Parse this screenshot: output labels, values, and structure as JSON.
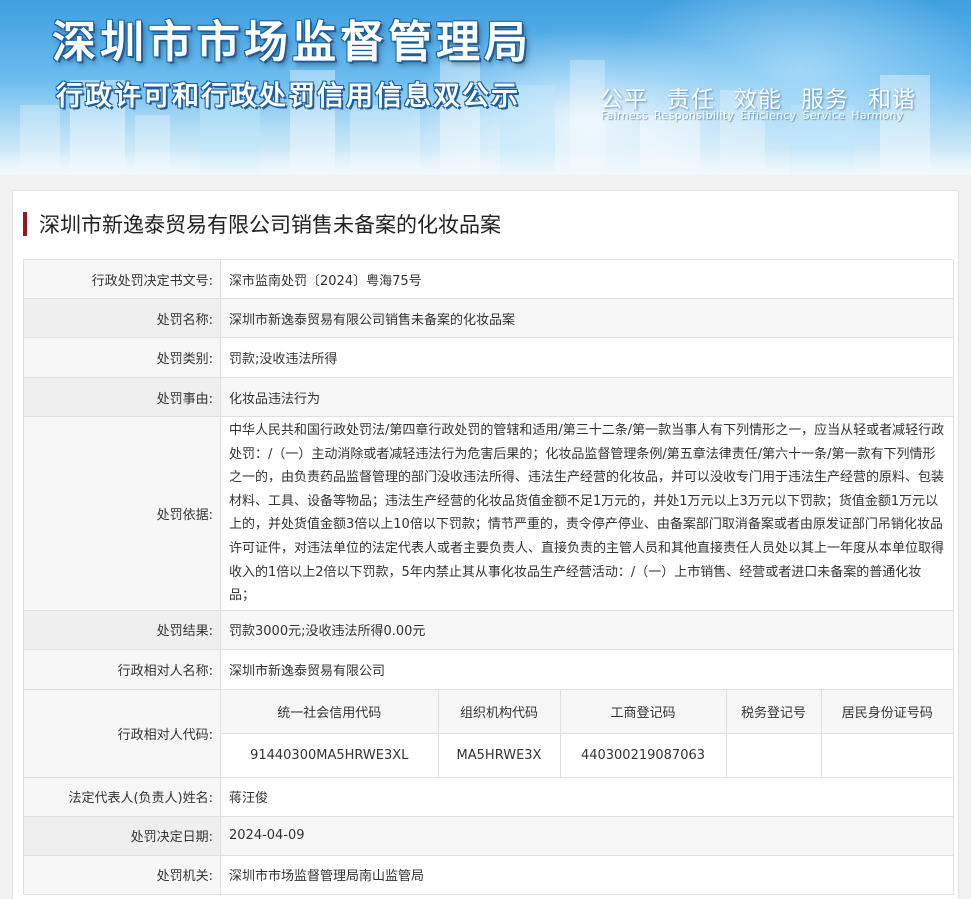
{
  "banner": {
    "title": "深圳市市场监督管理局",
    "subtitle": "行政许可和行政处罚信用信息双公示",
    "slogans_cn": [
      "公平",
      "责任",
      "效能",
      "服务",
      "和谐"
    ],
    "slogans_en": [
      "Fairness",
      "Responsibility",
      "Efficiency",
      "Service",
      "Harmony"
    ]
  },
  "page_title": "深圳市新逸泰贸易有限公司销售未备案的化妆品案",
  "details": {
    "decision_no_label": "行政处罚决定书文号:",
    "decision_no": "深市监南处罚〔2024〕粤海75号",
    "penalty_name_label": "处罚名称:",
    "penalty_name": "深圳市新逸泰贸易有限公司销售未备案的化妆品案",
    "penalty_type_label": "处罚类别:",
    "penalty_type": "罚款;没收违法所得",
    "penalty_reason_label": "处罚事由:",
    "penalty_reason": "化妆品违法行为",
    "penalty_basis_label": "处罚依据:",
    "penalty_basis": "中华人民共和国行政处罚法/第四章行政处罚的管辖和适用/第三十二条/第一款当事人有下列情形之一，应当从轻或者减轻行政处罚：/（一）主动消除或者减轻违法行为危害后果的；化妆品监督管理条例/第五章法律责任/第六十一条/第一款有下列情形之一的，由负责药品监督管理的部门没收违法所得、违法生产经营的化妆品，并可以没收专门用于违法生产经营的原料、包装材料、工具、设备等物品；违法生产经营的化妆品货值金额不足1万元的，并处1万元以上3万元以下罚款；货值金额1万元以上的，并处货值金额3倍以上10倍以下罚款；情节严重的，责令停产停业、由备案部门取消备案或者由原发证部门吊销化妆品许可证件，对违法单位的法定代表人或者主要负责人、直接负责的主管人员和其他直接责任人员处以其上一年度从本单位取得收入的1倍以上2倍以下罚款，5年内禁止其从事化妆品生产经营活动：/（一）上市销售、经营或者进口未备案的普通化妆品；",
    "penalty_result_label": "处罚结果:",
    "penalty_result": "罚款3000元;没收违法所得0.00元",
    "party_name_label": "行政相对人名称:",
    "party_name": "深圳市新逸泰贸易有限公司",
    "party_code_label": "行政相对人代码:",
    "codes": {
      "headers": [
        "统一社会信用代码",
        "组织机构代码",
        "工商登记码",
        "税务登记号",
        "居民身份证号码"
      ],
      "values": [
        "91440300MA5HRWE3XL",
        "MA5HRWE3X",
        "440300219087063",
        "",
        ""
      ]
    },
    "legal_rep_label": "法定代表人(负责人)姓名:",
    "legal_rep": "蒋汪俊",
    "decision_date_label": "处罚决定日期:",
    "decision_date": "2024-04-09",
    "authority_label": "处罚机关:",
    "authority": "深圳市市场监督管理局南山监管局"
  }
}
